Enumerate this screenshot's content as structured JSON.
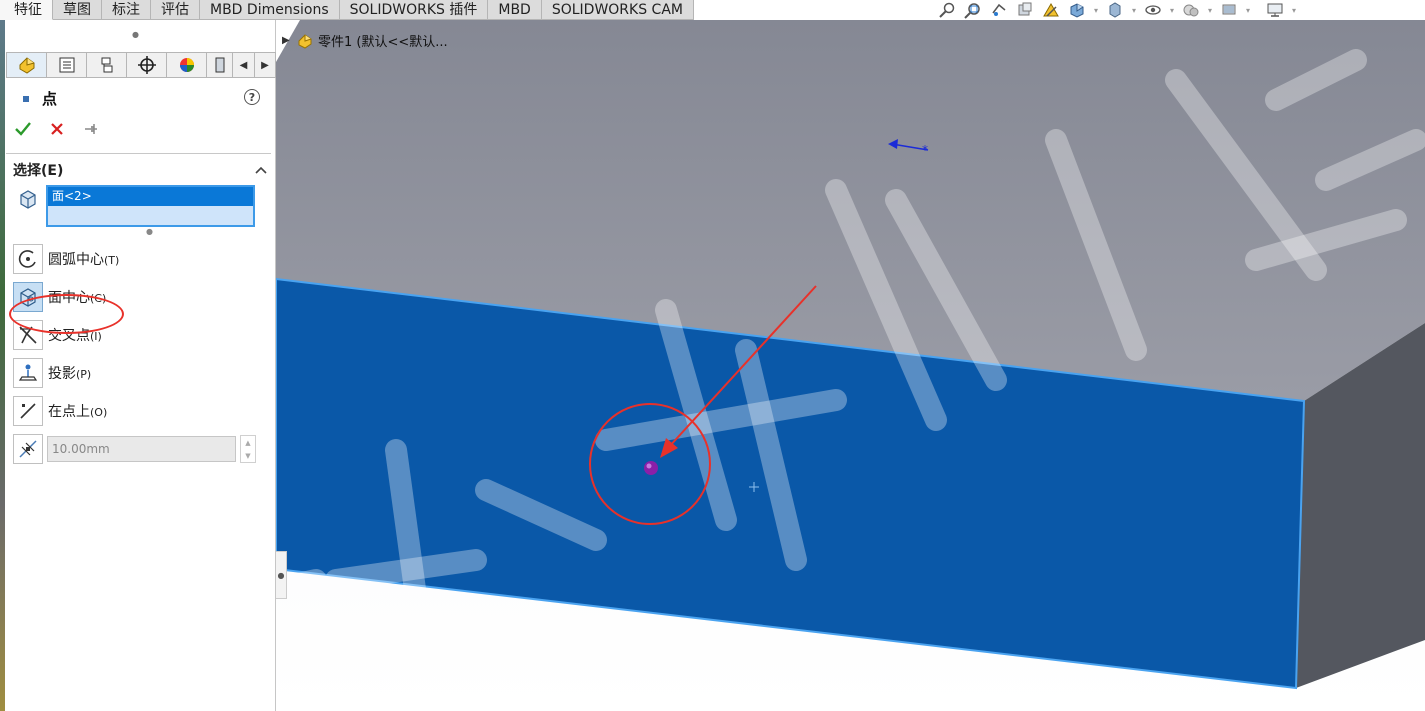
{
  "tabs": [
    {
      "label": "特征"
    },
    {
      "label": "草图"
    },
    {
      "label": "标注"
    },
    {
      "label": "评估"
    },
    {
      "label": "MBD Dimensions"
    },
    {
      "label": "SOLIDWORKS 插件"
    },
    {
      "label": "MBD"
    },
    {
      "label": "SOLIDWORKS CAM"
    }
  ],
  "property_manager": {
    "title": "点",
    "help_symbol": "?",
    "selection": {
      "section_label": "选择(E)",
      "items": [
        "面<2>"
      ]
    },
    "options": {
      "arc_center": "圆弧中心",
      "arc_center_key": "(T)",
      "face_center": "面中心",
      "face_center_key": "(C)",
      "intersection": "交叉点",
      "intersection_key": "(I)",
      "projection": "投影",
      "projection_key": "(P)",
      "on_point": "在点上",
      "on_point_key": "(O)"
    },
    "distance_value": "10.00mm"
  },
  "feature_tree": {
    "root_label": "零件1  (默认<<默认..."
  },
  "watermark": "大水牛测绘",
  "colors": {
    "selected_face": "#0a58a8",
    "face_edge": "#4aa3f0",
    "top_face": "#8a8d99",
    "side_face": "#54575f",
    "annotation_red": "#e8312a",
    "point_marker": "#8b1fa8"
  }
}
